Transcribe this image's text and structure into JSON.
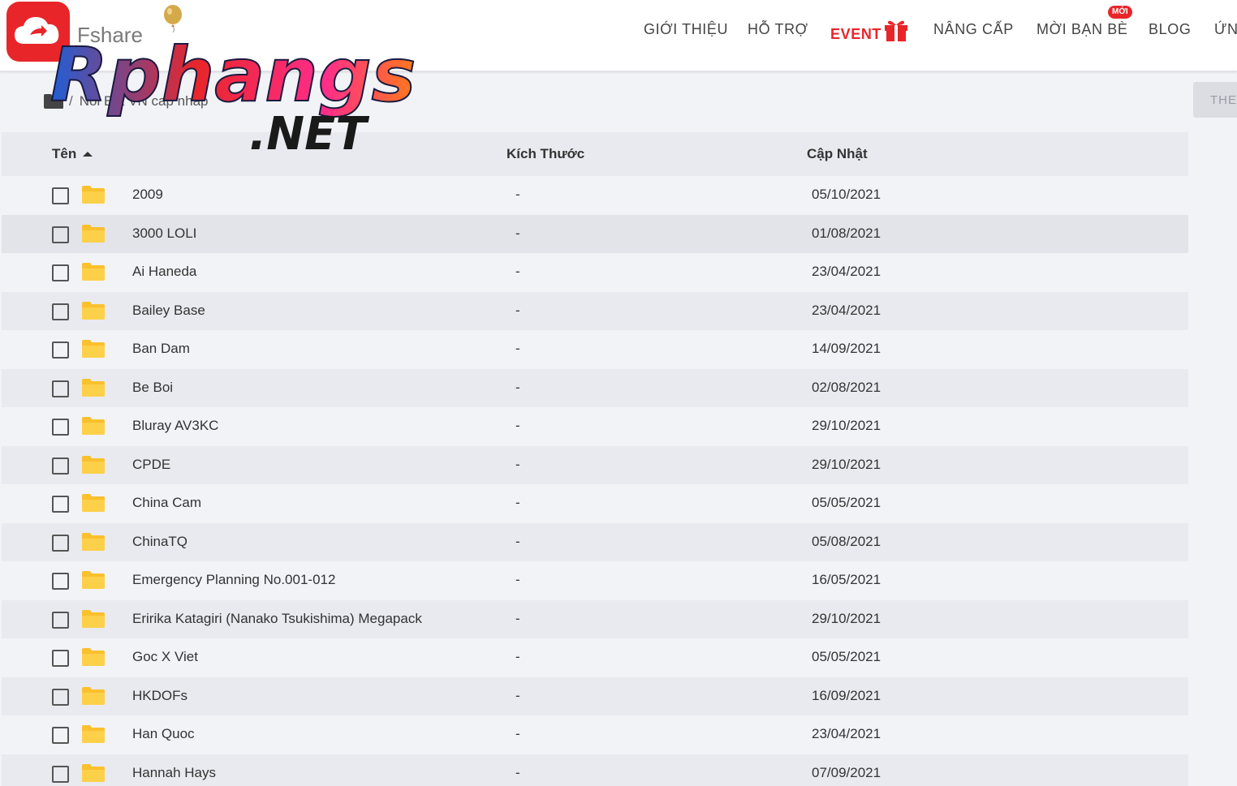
{
  "header": {
    "brand": "Fshare",
    "nav": [
      {
        "label": "GIỚI THIỆU"
      },
      {
        "label": "HỖ TRỢ"
      },
      {
        "label": "EVENT"
      },
      {
        "label": "NÂNG CẤP"
      },
      {
        "label": "MỜI BẠN BÈ"
      },
      {
        "label": "BLOG"
      },
      {
        "label": "ỨN"
      }
    ],
    "new_badge": "MỚI"
  },
  "watermark": {
    "line1": "Rphangs",
    "line2": ".NET"
  },
  "breadcrumb": {
    "path": "Noi Bat VN cap nhap"
  },
  "toolbar": {
    "theo_label": "THEO"
  },
  "table": {
    "columns": [
      "Tên",
      "Kích Thước",
      "Cập Nhật"
    ],
    "rows": [
      {
        "name": "2009",
        "size": "-",
        "updated": "05/10/2021"
      },
      {
        "name": "3000 LOLI",
        "size": "-",
        "updated": "01/08/2021"
      },
      {
        "name": "Ai Haneda",
        "size": "-",
        "updated": "23/04/2021"
      },
      {
        "name": "Bailey Base",
        "size": "-",
        "updated": "23/04/2021"
      },
      {
        "name": "Ban Dam",
        "size": "-",
        "updated": "14/09/2021"
      },
      {
        "name": "Be Boi",
        "size": "-",
        "updated": "02/08/2021"
      },
      {
        "name": "Bluray AV3KC",
        "size": "-",
        "updated": "29/10/2021"
      },
      {
        "name": "CPDE",
        "size": "-",
        "updated": "29/10/2021"
      },
      {
        "name": "China Cam",
        "size": "-",
        "updated": "05/05/2021"
      },
      {
        "name": "ChinaTQ",
        "size": "-",
        "updated": "05/08/2021"
      },
      {
        "name": "Emergency Planning No.001-012",
        "size": "-",
        "updated": "16/05/2021"
      },
      {
        "name": "Eririka Katagiri (Nanako Tsukishima) Megapack",
        "size": "-",
        "updated": "29/10/2021"
      },
      {
        "name": "Goc X Viet",
        "size": "-",
        "updated": "05/05/2021"
      },
      {
        "name": "HKDOFs",
        "size": "-",
        "updated": "16/09/2021"
      },
      {
        "name": "Han Quoc",
        "size": "-",
        "updated": "23/04/2021"
      },
      {
        "name": "Hannah Hays",
        "size": "-",
        "updated": "07/09/2021"
      }
    ]
  },
  "colors": {
    "accent": "#e8262a",
    "folder": "#fbc02d",
    "row_alt": "#e9eaef",
    "background": "#f2f3f7"
  }
}
